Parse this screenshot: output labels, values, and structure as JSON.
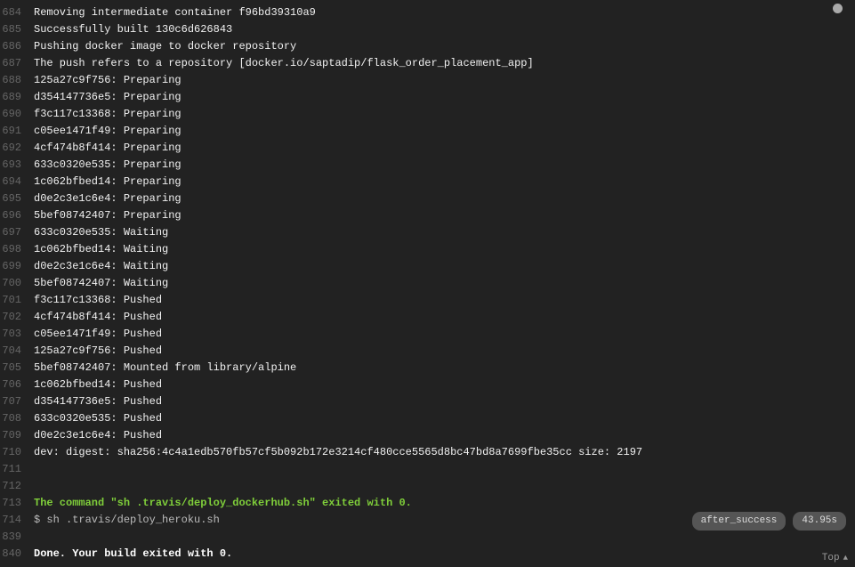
{
  "status_dot": "running",
  "top_link": "Top",
  "lines": [
    {
      "num": "684",
      "text": "Removing intermediate container f96bd39310a9",
      "style": "normal"
    },
    {
      "num": "685",
      "text": "Successfully built 130c6d626843",
      "style": "normal"
    },
    {
      "num": "686",
      "text": "Pushing docker image to docker repository",
      "style": "normal"
    },
    {
      "num": "687",
      "text": "The push refers to a repository [docker.io/saptadip/flask_order_placement_app]",
      "style": "normal"
    },
    {
      "num": "688",
      "text": "125a27c9f756: Preparing",
      "style": "normal"
    },
    {
      "num": "689",
      "text": "d354147736e5: Preparing",
      "style": "normal"
    },
    {
      "num": "690",
      "text": "f3c117c13368: Preparing",
      "style": "normal"
    },
    {
      "num": "691",
      "text": "c05ee1471f49: Preparing",
      "style": "normal"
    },
    {
      "num": "692",
      "text": "4cf474b8f414: Preparing",
      "style": "normal"
    },
    {
      "num": "693",
      "text": "633c0320e535: Preparing",
      "style": "normal"
    },
    {
      "num": "694",
      "text": "1c062bfbed14: Preparing",
      "style": "normal"
    },
    {
      "num": "695",
      "text": "d0e2c3e1c6e4: Preparing",
      "style": "normal"
    },
    {
      "num": "696",
      "text": "5bef08742407: Preparing",
      "style": "normal"
    },
    {
      "num": "697",
      "text": "633c0320e535: Waiting",
      "style": "normal"
    },
    {
      "num": "698",
      "text": "1c062bfbed14: Waiting",
      "style": "normal"
    },
    {
      "num": "699",
      "text": "d0e2c3e1c6e4: Waiting",
      "style": "normal"
    },
    {
      "num": "700",
      "text": "5bef08742407: Waiting",
      "style": "normal"
    },
    {
      "num": "701",
      "text": "f3c117c13368: Pushed",
      "style": "normal"
    },
    {
      "num": "702",
      "text": "4cf474b8f414: Pushed",
      "style": "normal"
    },
    {
      "num": "703",
      "text": "c05ee1471f49: Pushed",
      "style": "normal"
    },
    {
      "num": "704",
      "text": "125a27c9f756: Pushed",
      "style": "normal"
    },
    {
      "num": "705",
      "text": "5bef08742407: Mounted from library/alpine",
      "style": "normal"
    },
    {
      "num": "706",
      "text": "1c062bfbed14: Pushed",
      "style": "normal"
    },
    {
      "num": "707",
      "text": "d354147736e5: Pushed",
      "style": "normal"
    },
    {
      "num": "708",
      "text": "633c0320e535: Pushed",
      "style": "normal"
    },
    {
      "num": "709",
      "text": "d0e2c3e1c6e4: Pushed",
      "style": "normal"
    },
    {
      "num": "710",
      "text": "dev: digest: sha256:4c4a1edb570fb57cf5b092b172e3214cf480cce5565d8bc47bd8a7699fbe35cc size: 2197",
      "style": "normal"
    },
    {
      "num": "711",
      "text": "",
      "style": "normal"
    },
    {
      "num": "712",
      "text": "",
      "style": "normal"
    },
    {
      "num": "713",
      "text": "The command \"sh .travis/deploy_dockerhub.sh\" exited with 0.",
      "style": "green"
    },
    {
      "num": "714",
      "text": "$ sh .travis/deploy_heroku.sh",
      "style": "muted",
      "tags": [
        "after_success",
        "43.95s"
      ]
    },
    {
      "num": "839",
      "text": "",
      "style": "normal"
    },
    {
      "num": "840",
      "text": "Done. Your build exited with 0.",
      "style": "white-bold"
    }
  ]
}
